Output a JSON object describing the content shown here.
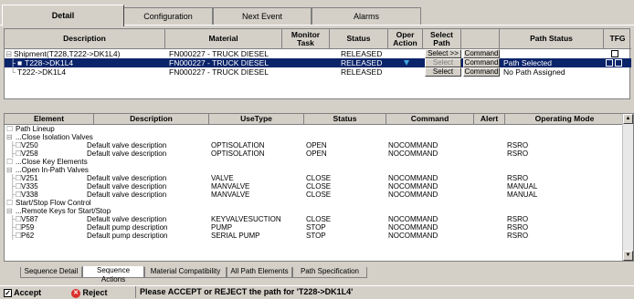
{
  "top_tabs": [
    "Detail",
    "Configuration",
    "Next Event",
    "Alarms"
  ],
  "grid1": {
    "headers": [
      "Description",
      "Material",
      "Monitor Task",
      "Status",
      "Oper Action",
      "Select Path",
      "",
      "Path Status",
      "TFG"
    ],
    "rows": [
      {
        "desc": "Shipment(T228,T222->DK1L4)",
        "material": "FN000227 - TRUCK DIESEL",
        "status": "RELEASED",
        "select": "Select >>",
        "command": "Command",
        "path_status": ""
      },
      {
        "desc": "T228->DK1L4",
        "material": "FN000227 - TRUCK DIESEL",
        "status": "RELEASED",
        "select": "Select",
        "command": "Command",
        "path_status": "Path Selected"
      },
      {
        "desc": "T222->DK1L4",
        "material": "FN000227 - TRUCK DIESEL",
        "status": "RELEASED",
        "select": "Select",
        "command": "Command",
        "path_status": "No Path Assigned"
      }
    ]
  },
  "grid2": {
    "headers": [
      "Element",
      "Description",
      "UseType",
      "Status",
      "Command",
      "Alert",
      "Operating Mode"
    ],
    "rows": [
      {
        "el": "Path Lineup",
        "group": true
      },
      {
        "el": "...Close Isolation Valves",
        "group": true
      },
      {
        "el": "V250",
        "desc": "Default valve description",
        "use": "OPTISOLATION",
        "status": "OPEN",
        "cmd": "NOCOMMAND",
        "mode": "RSRO"
      },
      {
        "el": "V258",
        "desc": "Default valve description",
        "use": "OPTISOLATION",
        "status": "OPEN",
        "cmd": "NOCOMMAND",
        "mode": "RSRO"
      },
      {
        "el": "...Close Key Elements",
        "group": true
      },
      {
        "el": "...Open In-Path Valves",
        "group": true
      },
      {
        "el": "V251",
        "desc": "Default valve description",
        "use": "VALVE",
        "status": "CLOSE",
        "cmd": "NOCOMMAND",
        "mode": "RSRO"
      },
      {
        "el": "V335",
        "desc": "Default valve description",
        "use": "MANVALVE",
        "status": "CLOSE",
        "cmd": "NOCOMMAND",
        "mode": "MANUAL"
      },
      {
        "el": "V338",
        "desc": "Default valve description",
        "use": "MANVALVE",
        "status": "CLOSE",
        "cmd": "NOCOMMAND",
        "mode": "MANUAL"
      },
      {
        "el": "Start/Stop Flow Control",
        "group": true
      },
      {
        "el": "...Remote Keys for Start/Stop",
        "group": true
      },
      {
        "el": "V587",
        "desc": "Default valve description",
        "use": "KEYVALVESUCTION",
        "status": "CLOSE",
        "cmd": "NOCOMMAND",
        "mode": "RSRO"
      },
      {
        "el": "P59",
        "desc": "Default pump description",
        "use": "PUMP",
        "status": "STOP",
        "cmd": "NOCOMMAND",
        "mode": "RSRO"
      },
      {
        "el": "P62",
        "desc": "Default pump description",
        "use": "SERIAL PUMP",
        "status": "STOP",
        "cmd": "NOCOMMAND",
        "mode": "RSRO"
      }
    ]
  },
  "bottom_tabs": [
    "Sequence Detail",
    "Sequence Actions",
    "Material Compatibility",
    "All Path Elements",
    "Path Specification"
  ],
  "status": {
    "accept": "Accept",
    "reject": "Reject",
    "message": "Please ACCEPT or REJECT the path for 'T228->DK1L4'"
  }
}
